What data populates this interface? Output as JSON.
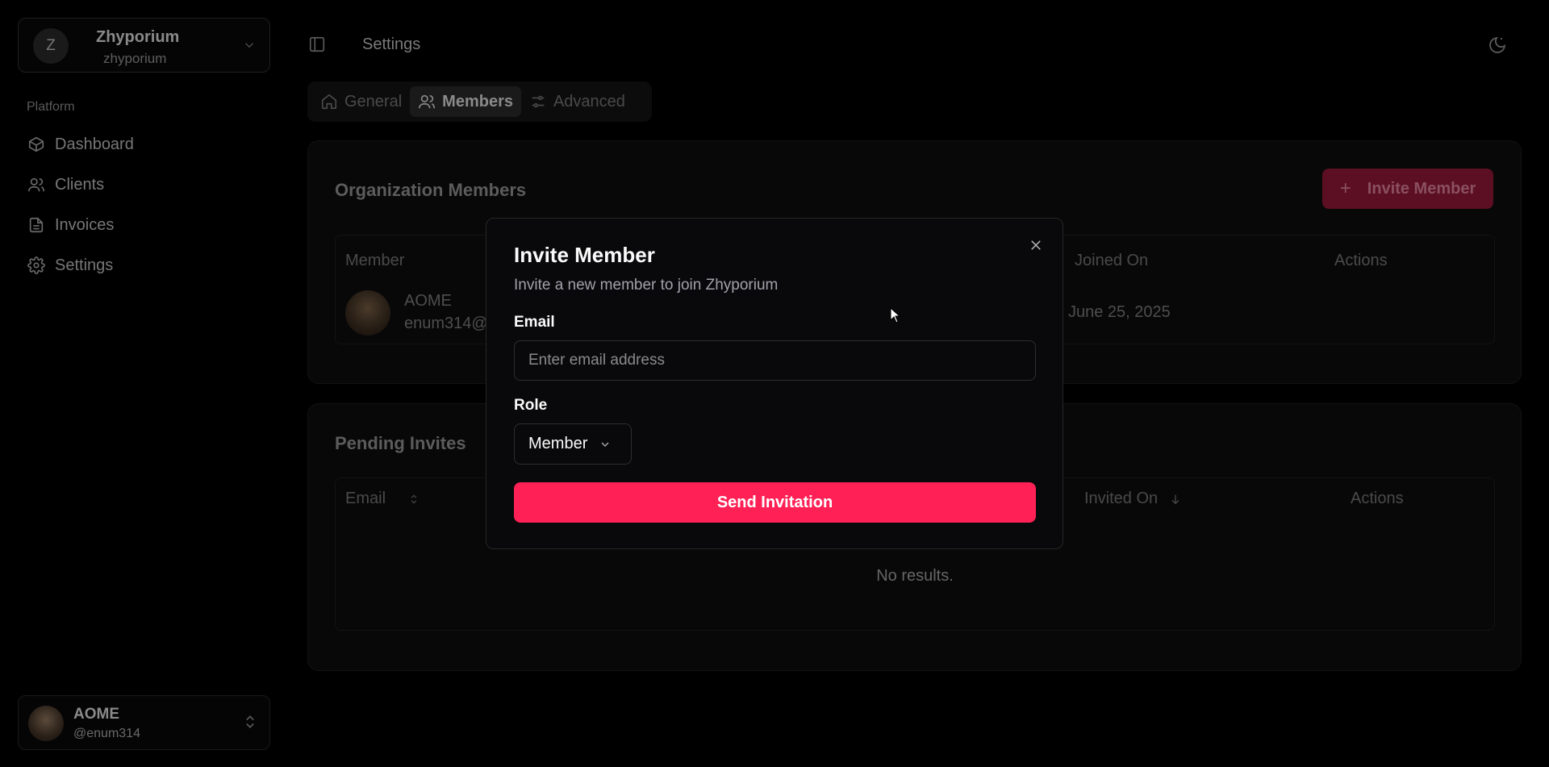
{
  "sidebar": {
    "org": {
      "initial": "Z",
      "name": "Zhyporium",
      "slug": "zhyporium"
    },
    "section_label": "Platform",
    "items": [
      {
        "label": "Dashboard",
        "icon": "box-icon"
      },
      {
        "label": "Clients",
        "icon": "users-icon"
      },
      {
        "label": "Invoices",
        "icon": "file-icon"
      },
      {
        "label": "Settings",
        "icon": "gear-icon"
      }
    ],
    "user": {
      "name": "AOME",
      "handle": "@enum314"
    }
  },
  "header": {
    "title": "Settings"
  },
  "tabs": [
    {
      "label": "General",
      "icon": "home-icon",
      "active": false
    },
    {
      "label": "Members",
      "icon": "users-icon",
      "active": true
    },
    {
      "label": "Advanced",
      "icon": "sliders-icon",
      "active": false
    }
  ],
  "members_card": {
    "title": "Organization Members",
    "invite_button": "Invite Member",
    "columns": [
      "Member",
      "Joined On",
      "Actions"
    ],
    "rows": [
      {
        "name": "AOME",
        "email": "enum314@",
        "joined": "June 25, 2025"
      }
    ]
  },
  "invites_card": {
    "title": "Pending Invites",
    "columns": [
      "Email",
      "Invited On",
      "Actions"
    ],
    "empty_text": "No results."
  },
  "modal": {
    "title": "Invite Member",
    "description": "Invite a new member to join Zhyporium",
    "email_label": "Email",
    "email_placeholder": "Enter email address",
    "role_label": "Role",
    "role_value": "Member",
    "submit_label": "Send Invitation"
  },
  "colors": {
    "accent": "#ff2156",
    "background": "#000000"
  }
}
